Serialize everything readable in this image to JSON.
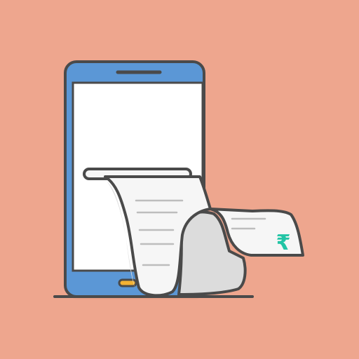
{
  "illustration": {
    "subject": "smartphone-with-printed-receipt",
    "receipt_symbol": "₹",
    "colors": {
      "background": "#EEA68E",
      "phone_body": "#5B97D6",
      "phone_screen": "#FFFFFF",
      "outline": "#4A4A4A",
      "receipt_paper": "#F6F6F6",
      "receipt_shadow": "#DCDCDC",
      "receipt_lines": "#BDBDBD",
      "home_button": "#F3B234",
      "currency_symbol": "#22C4A5"
    }
  }
}
